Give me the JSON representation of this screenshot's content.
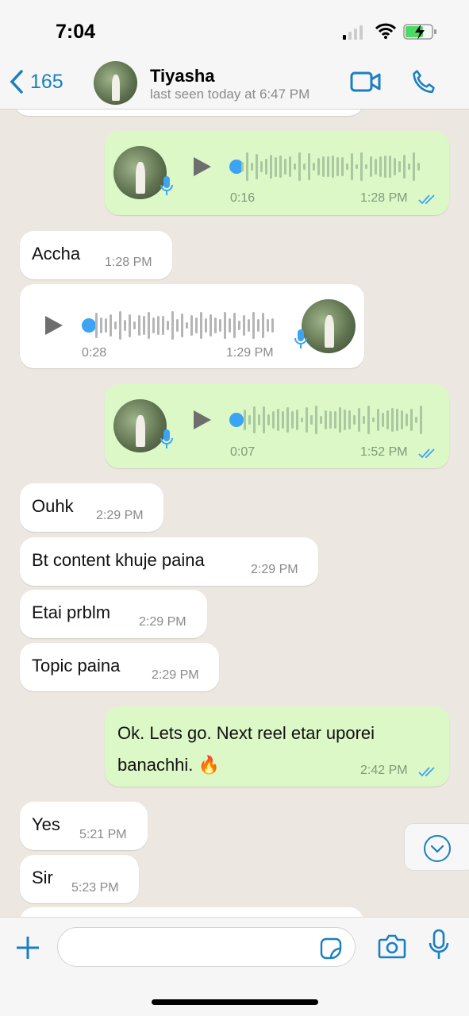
{
  "status_bar": {
    "time": "7:04",
    "battery": "charging"
  },
  "header": {
    "back_count": "165",
    "contact_name": "Tiyasha",
    "last_seen": "last seen today at 6:47 PM"
  },
  "colors": {
    "accent": "#1a7fc1",
    "outgoing_bubble": "#dcf8c6",
    "incoming_bubble": "#ffffff",
    "read_ticks": "#3da3f5"
  },
  "messages": [
    {
      "type": "voice",
      "direction": "out",
      "duration": "0:16",
      "time": "1:28 PM",
      "status": "read"
    },
    {
      "type": "text",
      "direction": "in",
      "text": "Accha",
      "time": "1:28 PM"
    },
    {
      "type": "voice",
      "direction": "in",
      "duration": "0:28",
      "time": "1:29 PM"
    },
    {
      "type": "voice",
      "direction": "out",
      "duration": "0:07",
      "time": "1:52 PM",
      "status": "read"
    },
    {
      "type": "text",
      "direction": "in",
      "text": "Ouhk",
      "time": "2:29 PM"
    },
    {
      "type": "text",
      "direction": "in",
      "text": "Bt content khuje paina",
      "time": "2:29 PM"
    },
    {
      "type": "text",
      "direction": "in",
      "text": "Etai prblm",
      "time": "2:29 PM"
    },
    {
      "type": "text",
      "direction": "in",
      "text": "Topic paina",
      "time": "2:29 PM"
    },
    {
      "type": "text",
      "direction": "out",
      "text": "Ok. Lets go. Next reel etar uporei banachhi. 🔥",
      "time": "2:42 PM",
      "status": "read"
    },
    {
      "type": "text",
      "direction": "in",
      "text": "Yes",
      "time": "5:21 PM"
    },
    {
      "type": "text",
      "direction": "in",
      "text": "Sir",
      "time": "5:23 PM"
    }
  ],
  "composer": {
    "value": "",
    "placeholder": ""
  }
}
